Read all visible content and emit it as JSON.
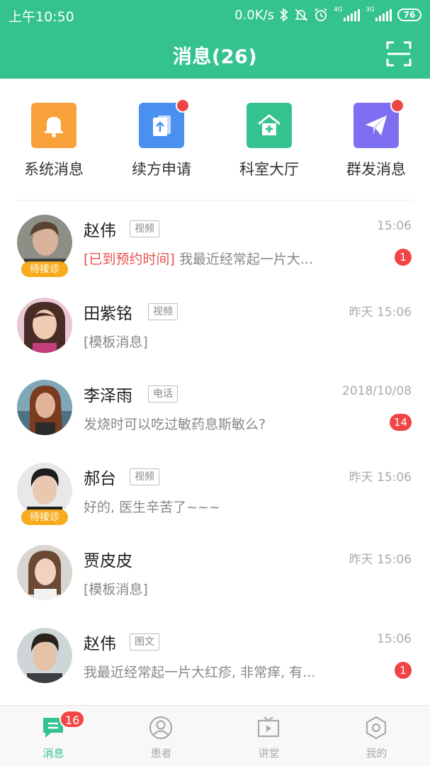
{
  "status_bar": {
    "time": "上午10:50",
    "speed": "0.0K/s",
    "net1": "4G",
    "net2": "3G",
    "battery": "76"
  },
  "header": {
    "title": "消息(26)"
  },
  "quick": [
    {
      "label": "系统消息",
      "color": "#f9a23b",
      "icon": "bell-icon",
      "dot": false
    },
    {
      "label": "续方申请",
      "color": "#4a90f0",
      "icon": "upload-doc-icon",
      "dot": true
    },
    {
      "label": "科室大厅",
      "color": "#34c28f",
      "icon": "hospital-icon",
      "dot": false
    },
    {
      "label": "群发消息",
      "color": "#7e6ff2",
      "icon": "send-icon",
      "dot": true
    }
  ],
  "messages": [
    {
      "name": "赵伟",
      "type": "视频",
      "time": "15:06",
      "highlight": "[已到预约时间]",
      "preview": " 我最近经常起一片大...",
      "badge": "1",
      "status_tag": "待接诊"
    },
    {
      "name": "田紫铭",
      "type": "视频",
      "time": "昨天 15:06",
      "highlight": "",
      "preview": "[模板消息]",
      "badge": "",
      "status_tag": ""
    },
    {
      "name": "李泽雨",
      "type": "电话",
      "time": "2018/10/08",
      "highlight": "",
      "preview": "发烧时可以吃过敏药息斯敏么?",
      "badge": "14",
      "status_tag": ""
    },
    {
      "name": "郝台",
      "type": "视频",
      "time": "昨天 15:06",
      "highlight": "",
      "preview": "好的, 医生辛苦了~~~",
      "badge": "",
      "status_tag": "待接诊"
    },
    {
      "name": "贾皮皮",
      "type": "",
      "time": "昨天 15:06",
      "highlight": "",
      "preview": "[模板消息]",
      "badge": "",
      "status_tag": ""
    },
    {
      "name": "赵伟",
      "type": "图文",
      "time": "15:06",
      "highlight": "",
      "preview": "我最近经常起一片大红疹, 非常痒, 有...",
      "badge": "1",
      "status_tag": ""
    }
  ],
  "tabs": [
    {
      "label": "消息",
      "badge": "16",
      "active": true
    },
    {
      "label": "患者",
      "badge": "",
      "active": false
    },
    {
      "label": "讲堂",
      "badge": "",
      "active": false
    },
    {
      "label": "我的",
      "badge": "",
      "active": false
    }
  ],
  "colors": {
    "primary": "#34c28f",
    "badge": "#f14545",
    "wait_tag": "#f8ab1d"
  }
}
